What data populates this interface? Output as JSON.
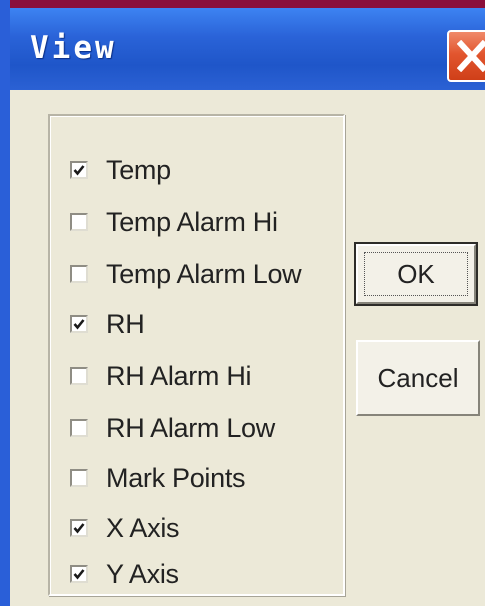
{
  "window": {
    "title": "View"
  },
  "options": [
    {
      "label": "Temp",
      "checked": true
    },
    {
      "label": "Temp Alarm Hi",
      "checked": false
    },
    {
      "label": "Temp Alarm Low",
      "checked": false
    },
    {
      "label": "RH",
      "checked": true
    },
    {
      "label": "RH Alarm Hi",
      "checked": false
    },
    {
      "label": "RH Alarm Low",
      "checked": false
    },
    {
      "label": "Mark Points",
      "checked": false
    },
    {
      "label": "X Axis",
      "checked": true
    },
    {
      "label": "Y Axis",
      "checked": true
    }
  ],
  "buttons": {
    "ok_label": "OK",
    "cancel_label": "Cancel"
  },
  "icons": {
    "close": "close-icon",
    "check": "checkmark-icon"
  },
  "colors": {
    "titlebar": "#2a63d8",
    "close_button": "#e2562f",
    "dialog_background": "#ece9d8"
  }
}
